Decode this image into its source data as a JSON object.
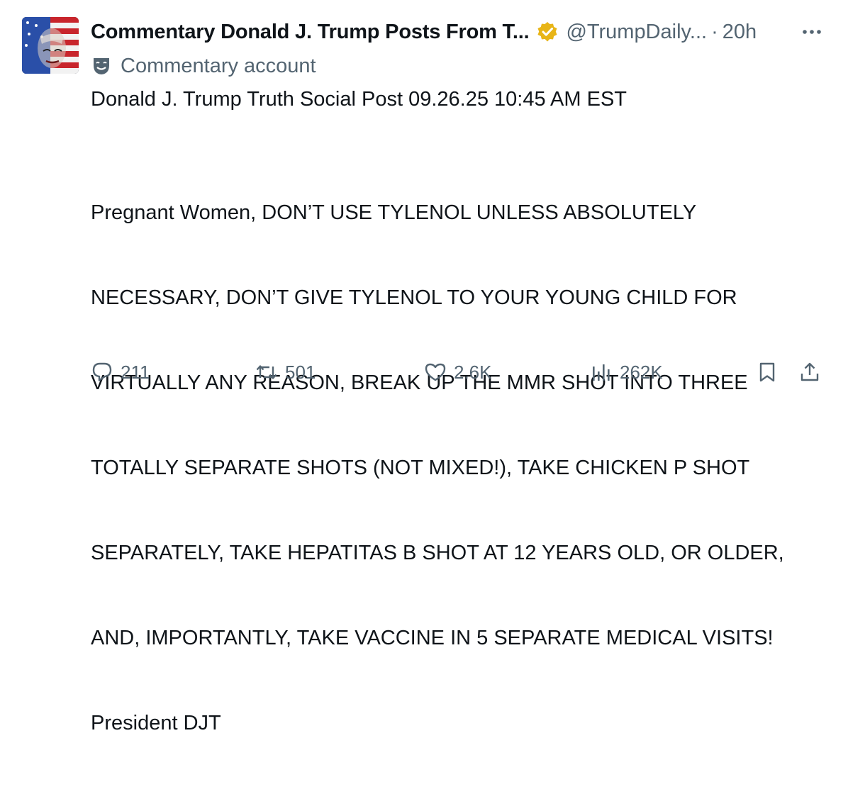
{
  "author": {
    "display_name": "Commentary Donald J. Trump Posts From T...",
    "handle": "@TrumpDaily...",
    "separator": "·",
    "time": "20h",
    "account_label": "Commentary account",
    "verified_color": "#e8b517",
    "avatar_icon": "flag-portrait-avatar"
  },
  "post": {
    "header_line": "Donald J. Trump Truth Social Post 09.26.25 10:45 AM EST",
    "lines": [
      "Pregnant Women, DON’T USE TYLENOL UNLESS ABSOLUTELY",
      "NECESSARY, DON’T GIVE TYLENOL TO YOUR YOUNG CHILD FOR",
      "VIRTUALLY ANY REASON, BREAK UP THE MMR SHOT INTO THREE",
      "TOTALLY SEPARATE SHOTS (NOT MIXED!), TAKE CHICKEN P SHOT",
      "SEPARATELY, TAKE HEPATITAS B SHOT AT 12 YEARS OLD, OR OLDER,",
      "AND, IMPORTANTLY, TAKE VACCINE IN 5 SEPARATE MEDICAL VISITS!",
      "President DJT"
    ]
  },
  "metrics": {
    "replies": "211",
    "reposts": "501",
    "likes": "2.6K",
    "views": "262K"
  },
  "colors": {
    "text_primary": "#0f1419",
    "text_secondary": "#536471",
    "background": "#ffffff"
  }
}
